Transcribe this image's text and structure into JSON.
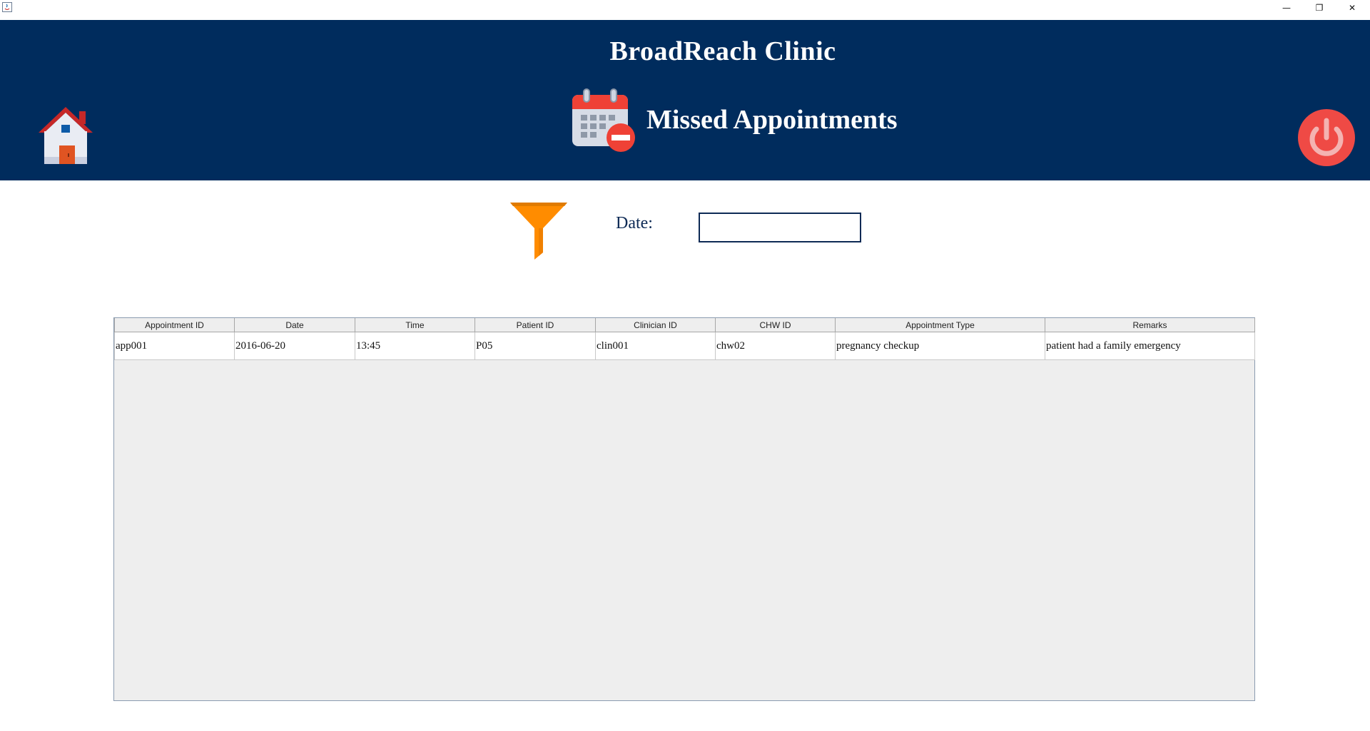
{
  "window": {
    "minimize_glyph": "—",
    "restore_glyph": "❐",
    "close_glyph": "✕"
  },
  "header": {
    "clinic_name": "BroadReach Clinic",
    "page_title": "Missed Appointments",
    "background_color": "#002c5d",
    "icons": [
      "home-icon",
      "calendar-remove-icon",
      "power-icon"
    ]
  },
  "filter": {
    "icon": "funnel-icon",
    "date_label": "Date:",
    "date_value": "",
    "date_placeholder": ""
  },
  "table": {
    "columns": [
      "Appointment ID",
      "Date",
      "Time",
      "Patient ID",
      "Clinician ID",
      "CHW ID",
      "Appointment Type",
      "Remarks"
    ],
    "rows": [
      [
        "app001",
        "2016-06-20",
        "13:45",
        "P05",
        "clin001",
        "chw02",
        "pregnancy checkup",
        "patient had a family emergency"
      ]
    ]
  }
}
